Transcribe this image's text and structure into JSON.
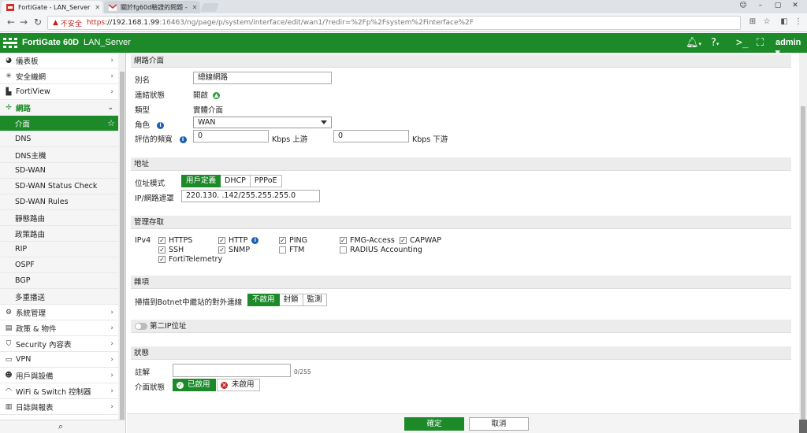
{
  "browser": {
    "tabs": [
      {
        "title": "FortiGate - LAN_Server"
      },
      {
        "title": "關於fg60d驗證的問題 -"
      }
    ],
    "url": {
      "security_label": "不安全",
      "scheme": "https",
      "host": "://192.168.1.99",
      "path": ":16463/ng/page/p/system/interface/edit/wan1/?redir=%2Fp%2Fsystem%2Finterface%2F"
    }
  },
  "header": {
    "product": "FortiGate 60D",
    "hostname": "LAN_Server",
    "user": "admin"
  },
  "sidebar": {
    "items": [
      {
        "icon": "dashboard-icon",
        "label": "儀表板"
      },
      {
        "icon": "security-fabric-icon",
        "label": "安全織網"
      },
      {
        "icon": "fortiview-icon",
        "label": "FortiView"
      },
      {
        "icon": "network-icon",
        "label": "網路"
      },
      {
        "label": "介面"
      },
      {
        "label": "DNS"
      },
      {
        "label": "DNS主機"
      },
      {
        "label": "SD-WAN"
      },
      {
        "label": "SD-WAN Status Check"
      },
      {
        "label": "SD-WAN Rules"
      },
      {
        "label": "靜態路由"
      },
      {
        "label": "政策路由"
      },
      {
        "label": "RIP"
      },
      {
        "label": "OSPF"
      },
      {
        "label": "BGP"
      },
      {
        "label": "多重播送"
      },
      {
        "icon": "system-icon",
        "label": "系統管理"
      },
      {
        "icon": "policy-icon",
        "label": "政策 & 物件"
      },
      {
        "icon": "shield-icon",
        "label": "Security 內容表"
      },
      {
        "icon": "vpn-icon",
        "label": "VPN"
      },
      {
        "icon": "user-icon",
        "label": "用戶與設備"
      },
      {
        "icon": "wifi-icon",
        "label": "WiFi & Switch 控制器"
      },
      {
        "icon": "log-icon",
        "label": "日誌與報表"
      }
    ]
  },
  "form": {
    "sections": {
      "interface": "網路介面",
      "address": "地址",
      "admin_access": "管理存取",
      "misc": "雜項",
      "secondary_ip": "第二IP位址",
      "status": "狀態"
    },
    "alias": {
      "label": "別名",
      "value": "總線網路"
    },
    "link_status": {
      "label": "連結狀態",
      "value": "開啟"
    },
    "type": {
      "label": "類型",
      "value": "實體介面"
    },
    "role": {
      "label": "角色",
      "value": "WAN"
    },
    "bandwidth": {
      "label": "評估的頻寬",
      "upstream_value": "0",
      "upstream_unit": "Kbps 上游",
      "downstream_value": "0",
      "downstream_unit": "Kbps 下游"
    },
    "addressing_mode": {
      "label": "位址模式",
      "options": [
        "用戶定義",
        "DHCP",
        "PPPoE"
      ],
      "selected": "用戶定義"
    },
    "ip_netmask": {
      "label": "IP/網路遮罩",
      "value": "220.130.    .142/255.255.255.0"
    },
    "ipv4_label": "IPv4",
    "access": [
      {
        "label": "HTTPS",
        "checked": true
      },
      {
        "label": "HTTP",
        "checked": true,
        "info": true
      },
      {
        "label": "PING",
        "checked": true
      },
      {
        "label": "FMG-Access",
        "checked": true
      },
      {
        "label": "CAPWAP",
        "checked": true
      },
      {
        "label": "SSH",
        "checked": true
      },
      {
        "label": "SNMP",
        "checked": true
      },
      {
        "label": "FTM",
        "checked": false
      },
      {
        "label": "RADIUS Accounting",
        "checked": false
      },
      {
        "label": "FortiTelemetry",
        "checked": true
      }
    ],
    "botnet": {
      "label": "掃描到Botnet中繼站的對外連線",
      "options": [
        "不啟用",
        "封鎖",
        "監測"
      ],
      "selected": "不啟用"
    },
    "comments": {
      "label": "註解",
      "counter": "0/255"
    },
    "interface_state": {
      "label": "介面狀態",
      "enabled": "已啟用",
      "disabled": "未啟用"
    }
  },
  "footer": {
    "ok": "確定",
    "cancel": "取消"
  },
  "colors": {
    "brand_green": "#1d8a2a"
  }
}
